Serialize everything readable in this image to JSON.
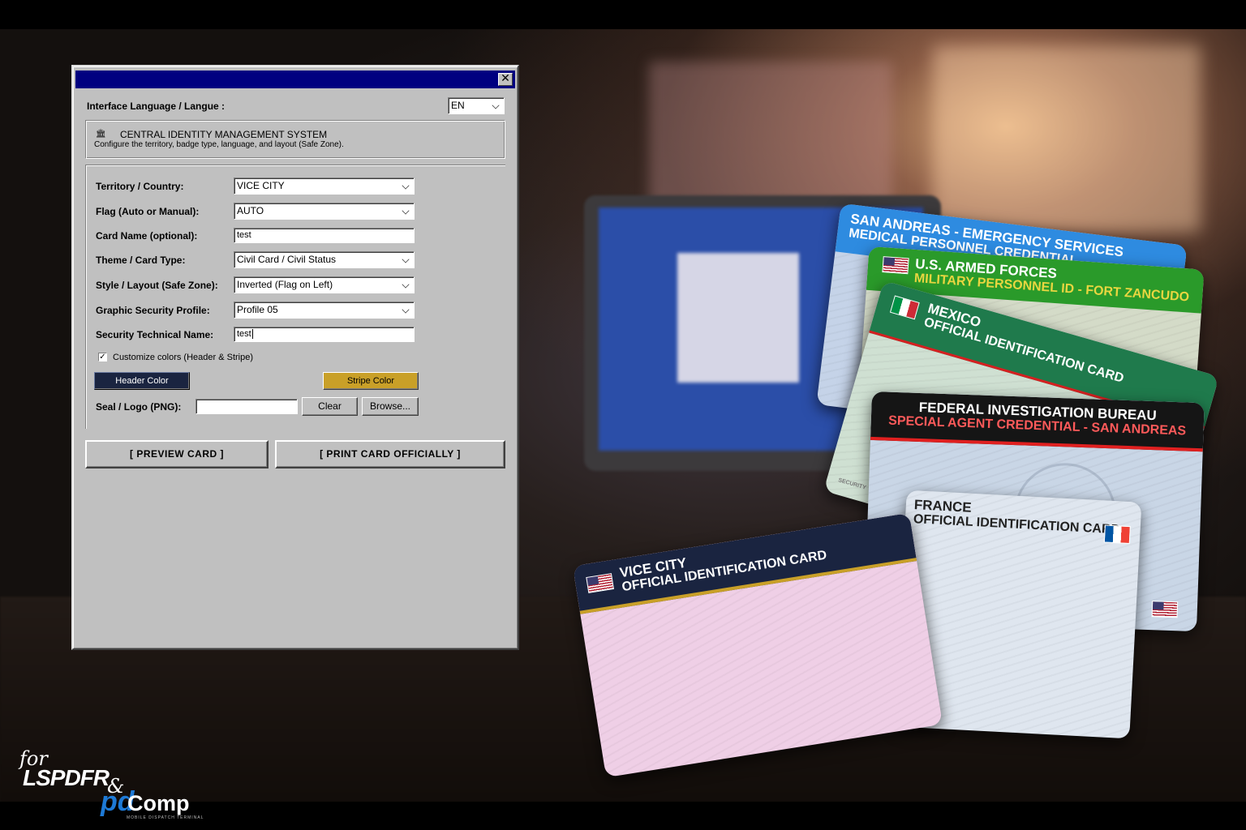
{
  "dialog": {
    "language_label": "Interface Language / Langue :",
    "language_value": "EN",
    "header": {
      "title": "CENTRAL IDENTITY MANAGEMENT SYSTEM",
      "description": "Configure the territory, badge type, language, and layout (Safe Zone)."
    },
    "fields": {
      "territory": {
        "label": "Territory / Country:",
        "value": "VICE CITY"
      },
      "flag": {
        "label": "Flag (Auto or Manual):",
        "value": "AUTO"
      },
      "card_name": {
        "label": "Card Name (optional):",
        "value": "test"
      },
      "theme": {
        "label": "Theme / Card Type:",
        "value": "Civil Card / Civil Status"
      },
      "style": {
        "label": "Style / Layout (Safe Zone):",
        "value": "Inverted (Flag on Left)"
      },
      "security_profile": {
        "label": "Graphic Security Profile:",
        "value": "Profile 05"
      },
      "security_name": {
        "label": "Security Technical Name:",
        "value": "test"
      }
    },
    "customize_colors": {
      "label": "Customize colors (Header & Stripe)",
      "checked": true
    },
    "header_color_button": "Header Color",
    "stripe_color_button": "Stripe Color",
    "header_color": "#1a2440",
    "stripe_color": "#c9a028",
    "seal": {
      "label": "Seal / Logo (PNG):",
      "value": "",
      "clear": "Clear",
      "browse": "Browse..."
    },
    "preview_button": "[ PREVIEW CARD ]",
    "print_button": "[ PRINT CARD OFFICIALLY ]"
  },
  "cards": [
    {
      "line1": "SAN ANDREAS - EMERGENCY SERVICES",
      "line2": "MEDICAL PERSONNEL CREDENTIAL",
      "color": "#2e8be0"
    },
    {
      "line1": "U.S. ARMED FORCES",
      "line2": "MILITARY PERSONNEL ID - FORT ZANCUDO",
      "color": "#2a9a2a"
    },
    {
      "line1": "MEXICO",
      "line2": "OFFICIAL IDENTIFICATION CARD",
      "color": "#1f7a4c"
    },
    {
      "line1": "FEDERAL INVESTIGATION BUREAU",
      "line2": "SPECIAL AGENT CREDENTIAL - SAN ANDREAS",
      "color": "#151515"
    },
    {
      "line1": "FRANCE",
      "line2": "OFFICIAL IDENTIFICATION CARD",
      "color": "#dfe6ef"
    },
    {
      "line1": "VICE CITY",
      "line2": "OFFICIAL IDENTIFICATION CARD",
      "color": "#1a2440"
    }
  ],
  "card_notes": {
    "security": "SECURITY"
  },
  "branding": {
    "for": "for",
    "lspdfr": "LSPDFR",
    "amp": "&",
    "pd": "pd",
    "comp": "Comp",
    "tagline": "MOBILE DISPATCH TERMINAL"
  }
}
